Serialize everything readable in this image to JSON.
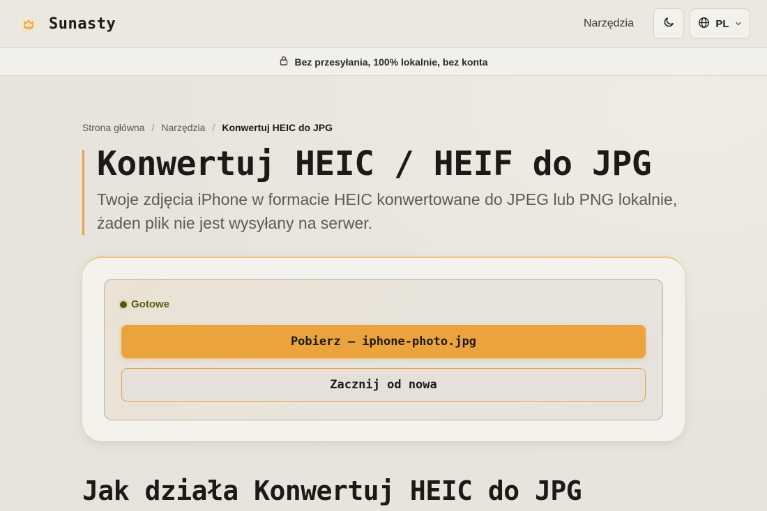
{
  "header": {
    "brand_name": "Sunasty",
    "logo_icon": "cat-logo-icon",
    "nav_tools": "Narzędzia",
    "theme_icon": "moon-icon",
    "lang_icon": "globe-icon",
    "lang_label": "PL",
    "lang_chevron": "chevron-down-icon"
  },
  "banner": {
    "icon": "lock-icon",
    "text": "Bez przesyłania, 100% lokalnie, bez konta"
  },
  "breadcrumb": {
    "home": "Strona główna",
    "sep1": "/",
    "tools": "Narzędzia",
    "sep2": "/",
    "current": "Konwertuj HEIC do JPG"
  },
  "main": {
    "title": "Konwertuj HEIC / HEIF do JPG",
    "subtitle": "Twoje zdjęcia iPhone w formacie HEIC konwertowane do JPEG lub PNG lokalnie, żaden plik nie jest wysyłany na serwer."
  },
  "tool": {
    "status": "Gotowe",
    "download_label": "Pobierz — iphone-photo.jpg",
    "restart_label": "Zacznij od nowa"
  },
  "section": {
    "heading": "Jak działa Konwertuj HEIC do JPG"
  },
  "colors": {
    "accent": "#eba43d",
    "status_green": "#4f5a12",
    "background": "#e8e5de"
  }
}
